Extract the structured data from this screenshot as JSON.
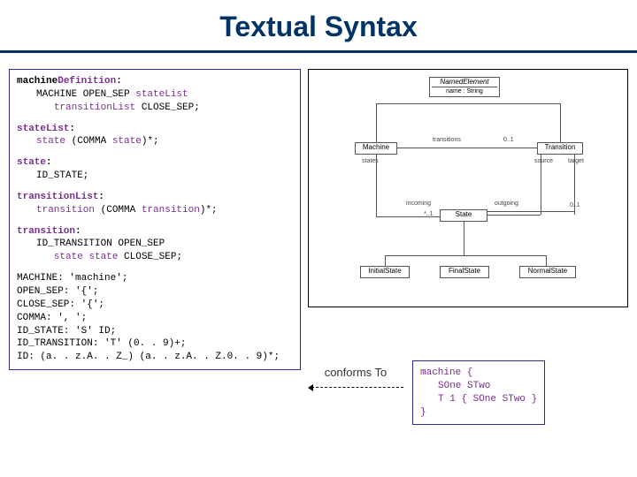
{
  "title": "Textual Syntax",
  "grammar": {
    "machineDef": {
      "head": "machineDefinition:",
      "body": "MACHINE OPEN_SEP stateList\n   transitionList CLOSE_SEP;"
    },
    "stateList": {
      "head": "stateList:",
      "body": "state (COMMA state)*;"
    },
    "state": {
      "head": "state:",
      "body": "ID_STATE;"
    },
    "transitionList": {
      "head": "transitionList:",
      "body": "transition (COMMA transition)*;"
    },
    "transition": {
      "head": "transition:",
      "body": "ID_TRANSITION OPEN_SEP\n   state state CLOSE_SEP;"
    },
    "tokens": {
      "machine": "MACHINE: 'machine';",
      "open": "OPEN_SEP: '{';",
      "close": "CLOSE_SEP: '{';",
      "comma": "COMMA: ', ';",
      "idstate": "ID_STATE: 'S' ID;",
      "idtrans": "ID_TRANSITION: 'T' (0. . 9)+;",
      "id": "ID: (a. . z.A. . Z_) (a. . z.A. . Z.0. . 9)*;"
    }
  },
  "diagram": {
    "named": {
      "title": "NamedElement",
      "attr": "name : String"
    },
    "machine": "Machine",
    "transition": "Transition",
    "state": "State",
    "initial": "InitialState",
    "final": "FinalState",
    "normal": "NormalState",
    "labels": {
      "transitions": "transitions",
      "states": "states",
      "incoming": "incoming",
      "outgoing": "outgoing",
      "source": "source",
      "target": "target",
      "one": "0..1",
      "star": "*",
      "starRange": "*..1"
    }
  },
  "conforms": "conforms To",
  "instance": {
    "l1": "machine {",
    "l2": "SOne STwo",
    "l3": "T 1 { SOne STwo }",
    "l4": "}"
  }
}
